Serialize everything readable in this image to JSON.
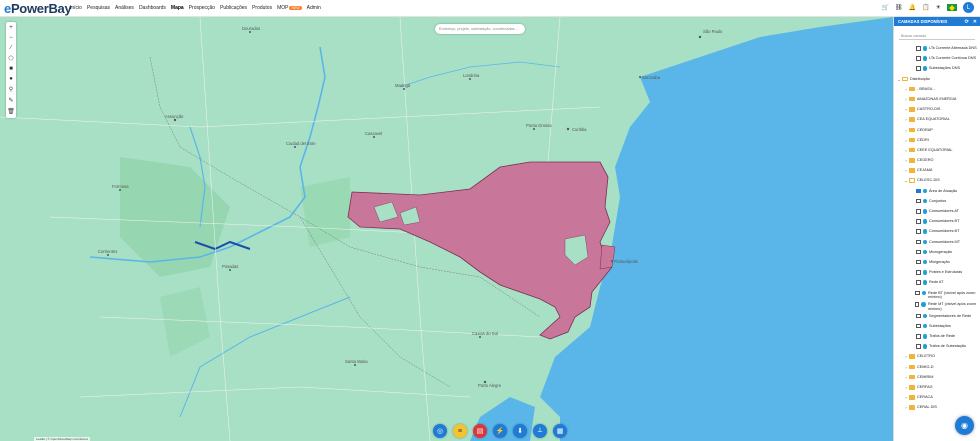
{
  "app": {
    "logo_e": "e",
    "logo_rest": "PowerBay"
  },
  "nav": {
    "items": [
      {
        "label": "Início"
      },
      {
        "label": "Pesquisas"
      },
      {
        "label": "Análises"
      },
      {
        "label": "Dashboards"
      },
      {
        "label": "Mapa"
      },
      {
        "label": "Prospecção"
      },
      {
        "label": "Publicações"
      },
      {
        "label": "Produtos"
      },
      {
        "label": "MOP"
      },
      {
        "label": "Admin"
      }
    ],
    "new_badge": "NEW",
    "active": "Mapa"
  },
  "user": {
    "avatar_letter": "L"
  },
  "map": {
    "search_placeholder": "Endereço, projeto, subestação, coordenadas...",
    "highlight_color": "#c8779a",
    "water_color": "#5ab6e8",
    "land_color": "#a8e0c6",
    "labels": [
      {
        "text": "Assunção",
        "sub": "Cidade"
      },
      {
        "text": "Curitiba"
      },
      {
        "text": "São Paulo"
      },
      {
        "text": "Campo Grande"
      },
      {
        "text": "Porto Alegre"
      },
      {
        "text": "Florianópolis"
      },
      {
        "text": "Londrina"
      },
      {
        "text": "Maringá"
      },
      {
        "text": "Cascavel"
      },
      {
        "text": "Ponta Grossa"
      },
      {
        "text": "Corrientes"
      },
      {
        "text": "Formosa"
      },
      {
        "text": "Posadas"
      },
      {
        "text": "Santa Maria"
      },
      {
        "text": "Caxias do Sul"
      },
      {
        "text": "Pelotas"
      },
      {
        "text": "Sorocaba"
      },
      {
        "text": "Ciudad del Este"
      },
      {
        "text": "Dourados"
      }
    ],
    "attribution": "Leaflet | © OpenStreetMap contributors"
  },
  "panel": {
    "title": "CAMADAS DISPONÍVEIS",
    "search_placeholder": "Buscar camada",
    "rows": [
      {
        "type": "layer",
        "label": "LTs Corrente Alternada DNS",
        "checked": false,
        "indent": 2
      },
      {
        "type": "layer",
        "label": "LTs Corrente Contínua DNS",
        "checked": false,
        "indent": 2
      },
      {
        "type": "layer",
        "label": "Subestações DNS",
        "checked": false,
        "indent": 2
      },
      {
        "type": "folder-open",
        "label": "Distribuição",
        "indent": 0
      },
      {
        "type": "folder",
        "label": "- BRASIL -",
        "indent": 1
      },
      {
        "type": "folder",
        "label": "AMAZONAS ENERGIA",
        "indent": 1
      },
      {
        "type": "folder",
        "label": "CASTRO-DIS",
        "indent": 1
      },
      {
        "type": "folder",
        "label": "CEA EQUATORIAL",
        "indent": 1
      },
      {
        "type": "folder",
        "label": "CEDRAP",
        "indent": 1
      },
      {
        "type": "folder",
        "label": "CEDRI",
        "indent": 1
      },
      {
        "type": "folder",
        "label": "CEEE EQUATORIAL",
        "indent": 1
      },
      {
        "type": "folder",
        "label": "CEGERO",
        "indent": 1
      },
      {
        "type": "folder",
        "label": "CEJAMA",
        "indent": 1
      },
      {
        "type": "folder-open",
        "label": "CELESC-DIS",
        "indent": 1
      },
      {
        "type": "layer",
        "label": "Área de Atuação",
        "checked": true,
        "indent": 2
      },
      {
        "type": "layer",
        "label": "Conjuntos",
        "checked": false,
        "indent": 2
      },
      {
        "type": "layer",
        "label": "Consumidores AT",
        "checked": false,
        "indent": 2
      },
      {
        "type": "layer",
        "label": "Consumidores BT",
        "checked": false,
        "indent": 2
      },
      {
        "type": "layer",
        "label": "Consumidores BT",
        "checked": false,
        "indent": 2
      },
      {
        "type": "layer",
        "label": "Consumidores MT",
        "checked": false,
        "indent": 2
      },
      {
        "type": "layer",
        "label": "Microgeração",
        "checked": false,
        "indent": 2
      },
      {
        "type": "layer",
        "label": "Minigeração",
        "checked": false,
        "indent": 2
      },
      {
        "type": "layer",
        "label": "Postes e Estruturas",
        "checked": false,
        "indent": 2
      },
      {
        "type": "layer",
        "label": "Rede AT",
        "checked": false,
        "indent": 2
      },
      {
        "type": "layer",
        "label": "Rede BT (visível após zoom mínimo)",
        "checked": false,
        "indent": 2
      },
      {
        "type": "layer",
        "label": "Rede MT (visível após zoom mínimo)",
        "checked": false,
        "indent": 2
      },
      {
        "type": "layer",
        "label": "Segmentadores de Rede",
        "checked": false,
        "indent": 2
      },
      {
        "type": "layer",
        "label": "Subestações",
        "checked": false,
        "indent": 2
      },
      {
        "type": "layer",
        "label": "Trafos de Rede",
        "checked": false,
        "indent": 2
      },
      {
        "type": "layer",
        "label": "Trafos de Subestação",
        "checked": false,
        "indent": 2
      },
      {
        "type": "folder",
        "label": "CELETRO",
        "indent": 1
      },
      {
        "type": "folder",
        "label": "CEMIG-D",
        "indent": 1
      },
      {
        "type": "folder",
        "label": "CEMIRIM",
        "indent": 1
      },
      {
        "type": "folder",
        "label": "CERFAG",
        "indent": 1
      },
      {
        "type": "folder",
        "label": "CERACA",
        "indent": 1
      },
      {
        "type": "folder",
        "label": "CERAL DIS",
        "indent": 1
      }
    ]
  }
}
